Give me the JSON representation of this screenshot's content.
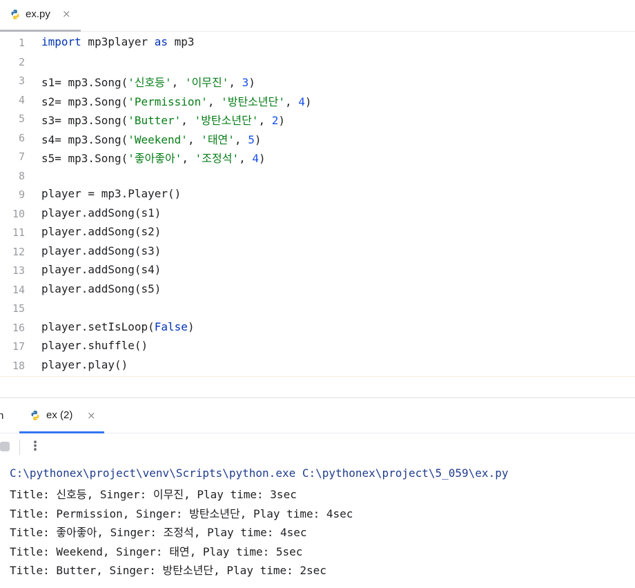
{
  "editor_tab": {
    "label": "ex.py",
    "close": "×"
  },
  "editor": {
    "line_numbers": [
      "1",
      "2",
      "3",
      "4",
      "5",
      "6",
      "7",
      "8",
      "9",
      "10",
      "11",
      "12",
      "13",
      "14",
      "15",
      "16",
      "17",
      "18"
    ],
    "lines": [
      [
        {
          "t": "import",
          "c": "kw"
        },
        {
          "t": " mp3player ",
          "c": ""
        },
        {
          "t": "as",
          "c": "kw"
        },
        {
          "t": " mp3",
          "c": ""
        }
      ],
      [],
      [
        {
          "t": "s1= mp3.Song(",
          "c": ""
        },
        {
          "t": "'신호등'",
          "c": "str"
        },
        {
          "t": ", ",
          "c": ""
        },
        {
          "t": "'이무진'",
          "c": "str"
        },
        {
          "t": ", ",
          "c": ""
        },
        {
          "t": "3",
          "c": "num"
        },
        {
          "t": ")",
          "c": ""
        }
      ],
      [
        {
          "t": "s2= mp3.Song(",
          "c": ""
        },
        {
          "t": "'Permission'",
          "c": "str"
        },
        {
          "t": ", ",
          "c": ""
        },
        {
          "t": "'방탄소년단'",
          "c": "str"
        },
        {
          "t": ", ",
          "c": ""
        },
        {
          "t": "4",
          "c": "num"
        },
        {
          "t": ")",
          "c": ""
        }
      ],
      [
        {
          "t": "s3= mp3.Song(",
          "c": ""
        },
        {
          "t": "'Butter'",
          "c": "str"
        },
        {
          "t": ", ",
          "c": ""
        },
        {
          "t": "'방탄소년단'",
          "c": "str"
        },
        {
          "t": ", ",
          "c": ""
        },
        {
          "t": "2",
          "c": "num"
        },
        {
          "t": ")",
          "c": ""
        }
      ],
      [
        {
          "t": "s4= mp3.Song(",
          "c": ""
        },
        {
          "t": "'Weekend'",
          "c": "str"
        },
        {
          "t": ", ",
          "c": ""
        },
        {
          "t": "'태연'",
          "c": "str"
        },
        {
          "t": ", ",
          "c": ""
        },
        {
          "t": "5",
          "c": "num"
        },
        {
          "t": ")",
          "c": ""
        }
      ],
      [
        {
          "t": "s5= mp3.Song(",
          "c": ""
        },
        {
          "t": "'좋아좋아'",
          "c": "str"
        },
        {
          "t": ", ",
          "c": ""
        },
        {
          "t": "'조정석'",
          "c": "str"
        },
        {
          "t": ", ",
          "c": ""
        },
        {
          "t": "4",
          "c": "num"
        },
        {
          "t": ")",
          "c": ""
        }
      ],
      [],
      [
        {
          "t": "player = mp3.Player()",
          "c": ""
        }
      ],
      [
        {
          "t": "player.addSong(s1)",
          "c": ""
        }
      ],
      [
        {
          "t": "player.addSong(s2)",
          "c": ""
        }
      ],
      [
        {
          "t": "player.addSong(s3)",
          "c": ""
        }
      ],
      [
        {
          "t": "player.addSong(s4)",
          "c": ""
        }
      ],
      [
        {
          "t": "player.addSong(s5)",
          "c": ""
        }
      ],
      [],
      [
        {
          "t": "player.setIsLoop(",
          "c": ""
        },
        {
          "t": "False",
          "c": "kw"
        },
        {
          "t": ")",
          "c": ""
        }
      ],
      [
        {
          "t": "player.shuffle()",
          "c": ""
        }
      ],
      [
        {
          "t": "player.play()",
          "c": ""
        }
      ]
    ]
  },
  "run_panel": {
    "cut_label": "n",
    "tab_label": "ex (2)",
    "tab_close": "×",
    "more_icon": "⋮"
  },
  "console": {
    "command": "C:\\pythonex\\project\\venv\\Scripts\\python.exe C:\\pythonex\\project\\5_059\\ex.py",
    "output": [
      "Title: 신호등, Singer: 이무진, Play time: 3sec",
      "Title: Permission, Singer: 방탄소년단, Play time: 4sec",
      "Title: 좋아좋아, Singer: 조정석, Play time: 4sec",
      "Title: Weekend, Singer: 태연, Play time: 5sec",
      "Title: Butter, Singer: 방탄소년단, Play time: 2sec"
    ]
  },
  "colors": {
    "keyword": "#0033b3",
    "string": "#067d17",
    "number": "#1750eb",
    "active_tab_underline": "#3574f0",
    "command_text": "#203d8c"
  }
}
